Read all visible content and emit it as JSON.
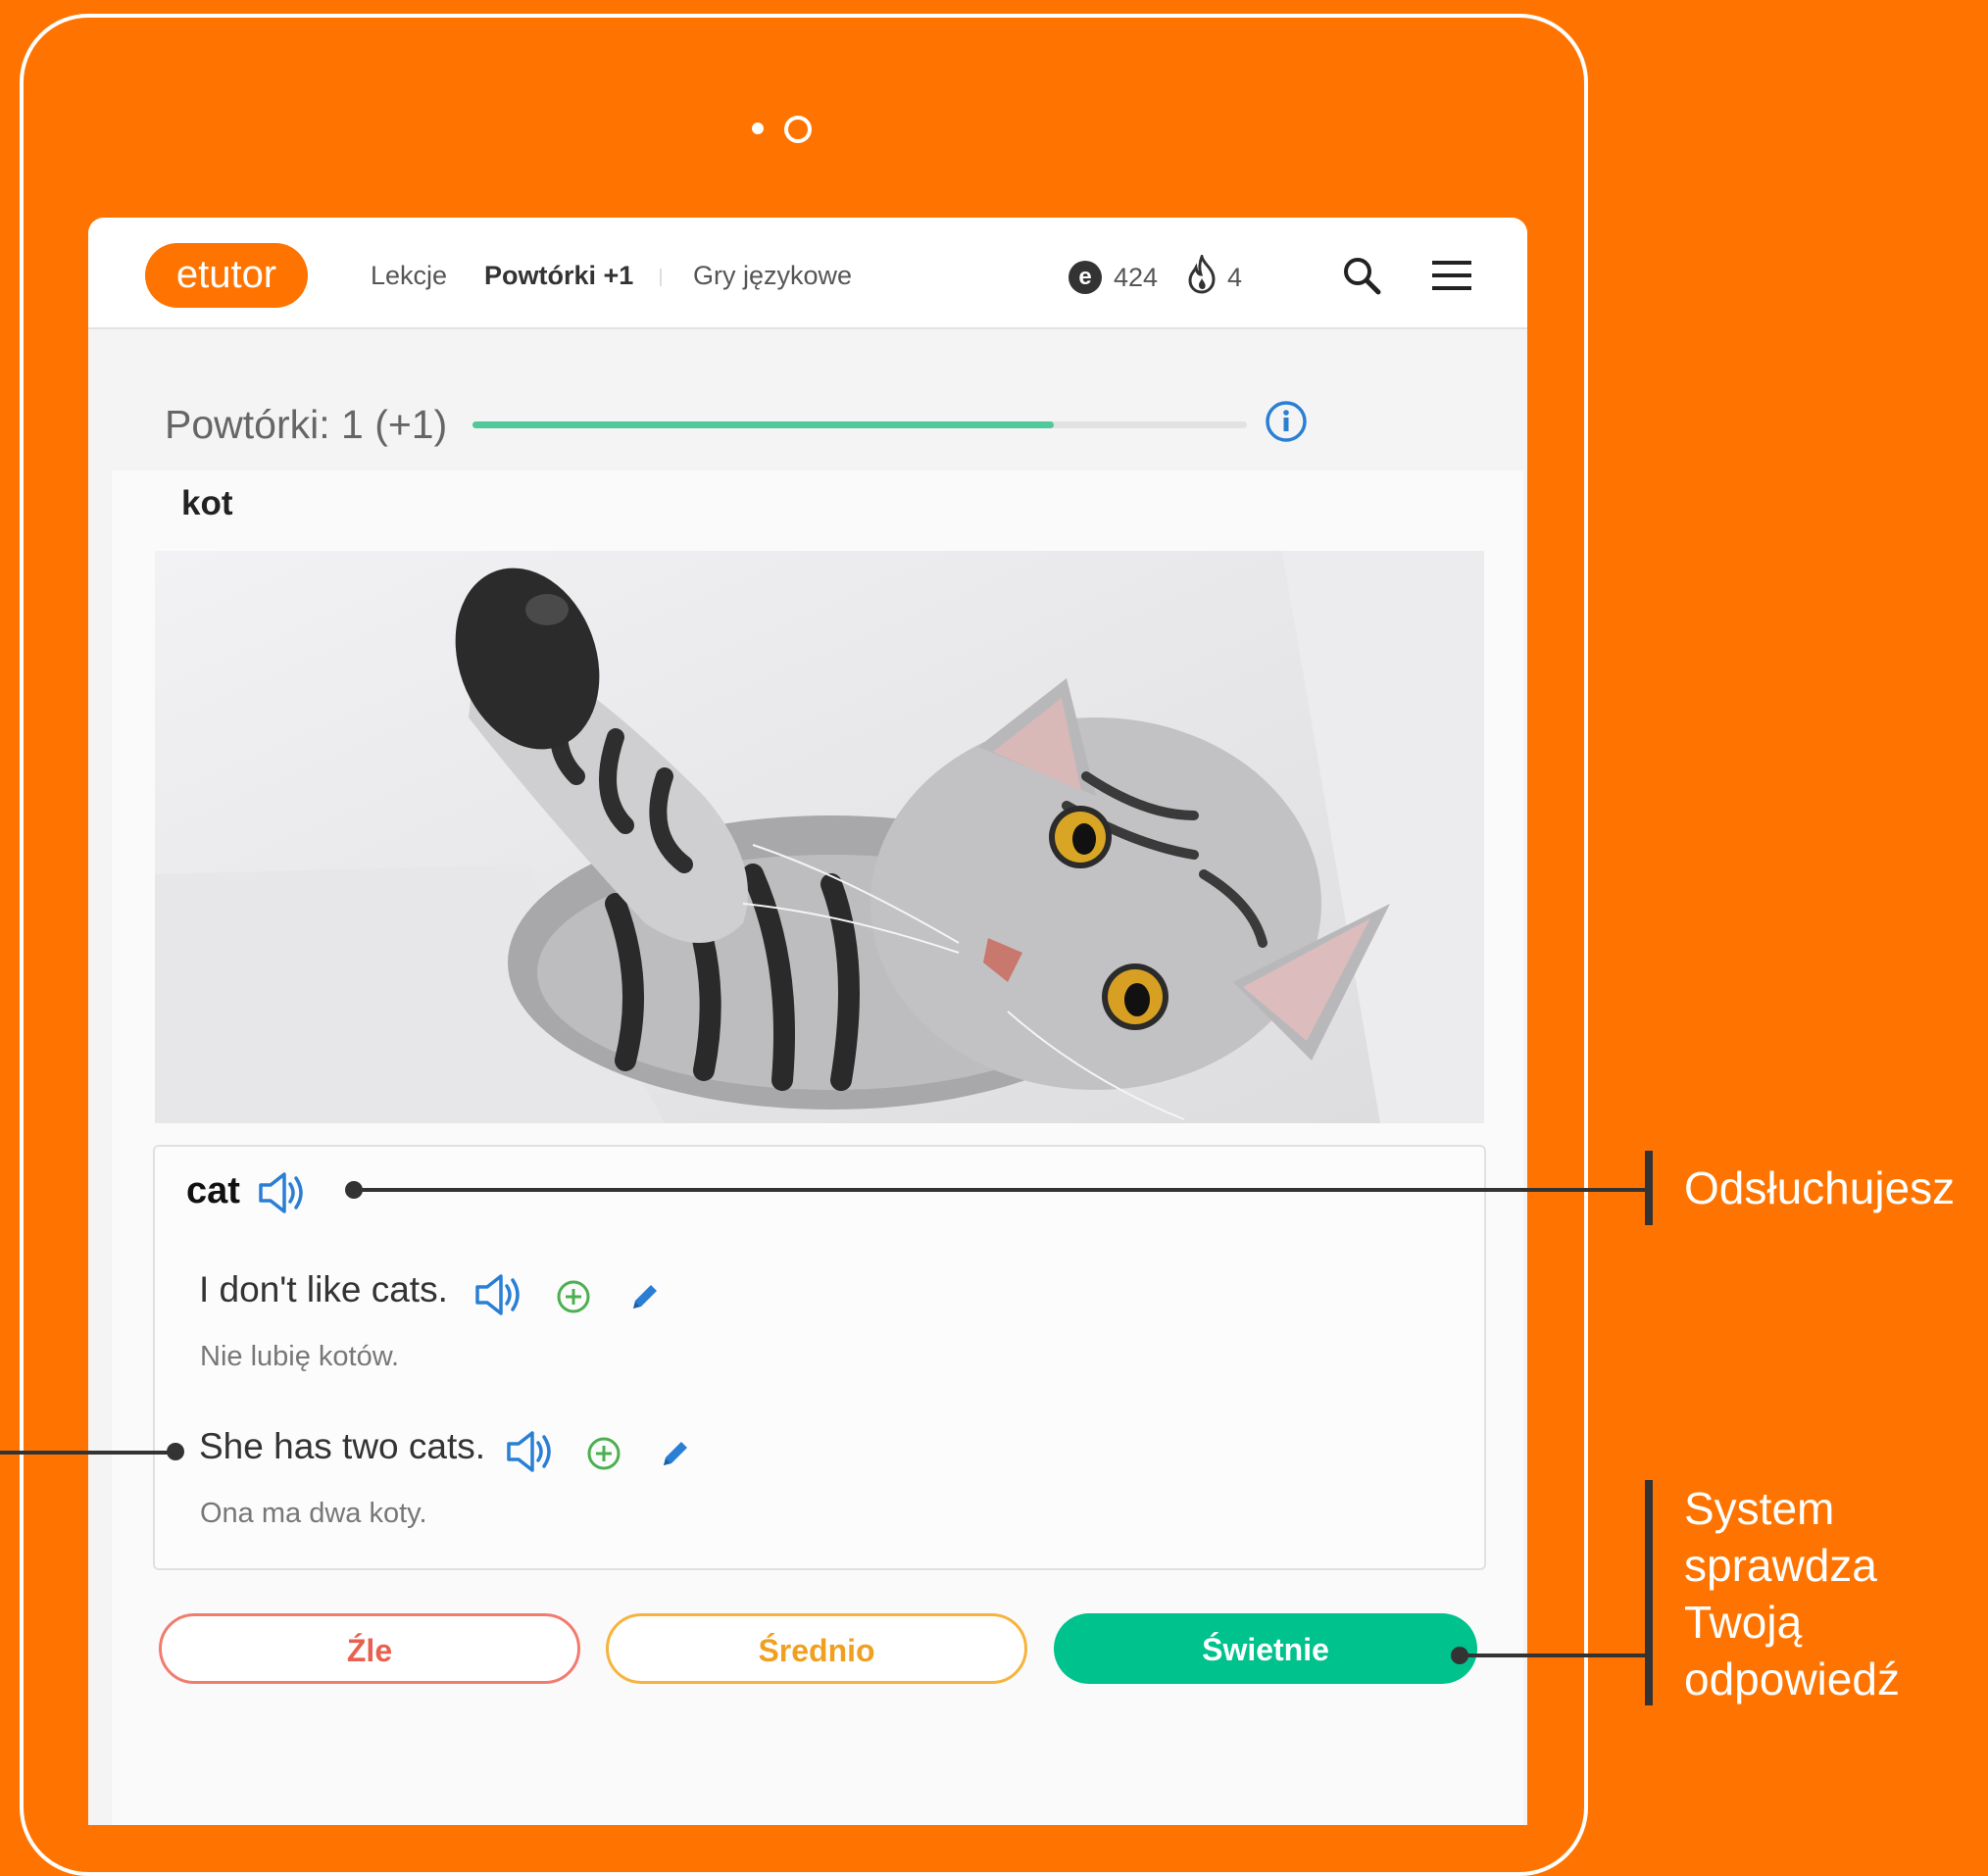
{
  "colors": {
    "background": "#FF7400",
    "accent_blue": "#2a7fd4",
    "success": "#00c28c",
    "plus_green": "#4caf50"
  },
  "header": {
    "logo": "etutor",
    "nav": [
      {
        "label": "Lekcje"
      },
      {
        "label": "Powtórki +1"
      },
      {
        "label": "Gry językowe"
      }
    ],
    "coins": "424",
    "streak": "4"
  },
  "progress": {
    "label": "Powtórki: 1 (+1)",
    "fraction": 0.75
  },
  "card": {
    "word_pl": "kot",
    "word_en": "cat",
    "examples": [
      {
        "sentence": "I don't like cats.",
        "translation": "Nie lubię kotów."
      },
      {
        "sentence": "She has two cats.",
        "translation": "Ona ma dwa koty."
      }
    ]
  },
  "buttons": {
    "bad": "Źle",
    "medium": "Średnio",
    "good": "Świetnie"
  },
  "callouts": {
    "listen": "Odsłuchujesz",
    "check_line1": "System",
    "check_line2": "sprawdza",
    "check_line3": "Twoją",
    "check_line4": "odpowiedź"
  }
}
